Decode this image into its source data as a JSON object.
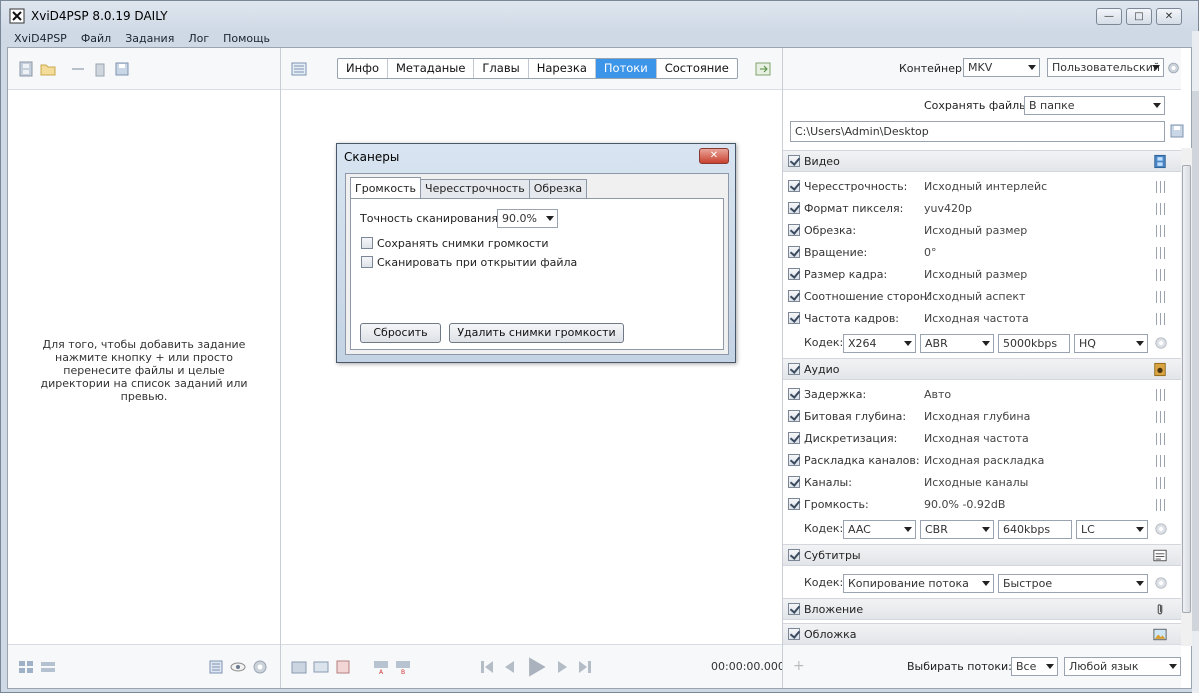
{
  "window": {
    "title": "XviD4PSP 8.0.19 DAILY"
  },
  "menu": [
    "XviD4PSP",
    "Файл",
    "Задания",
    "Лог",
    "Помощь"
  ],
  "left_pane": {
    "hint": "Для того, чтобы добавить задание нажмите кнопку + или просто перенесите файлы и целые директории на список заданий или превью."
  },
  "center_pane": {
    "tabs": [
      "Инфо",
      "Метаданые",
      "Главы",
      "Нарезка",
      "Потоки",
      "Состояние"
    ],
    "active_tab": "Потоки",
    "time": "00:00:00.000"
  },
  "dialog": {
    "title": "Сканеры",
    "close": "✕",
    "tabs": [
      "Громкость",
      "Чересстрочность",
      "Обрезка"
    ],
    "active_tab": "Громкость",
    "accuracy_label": "Точность сканирования:",
    "accuracy_value": "90.0%",
    "save_snapshots_label": "Сохранять снимки громкости",
    "scan_on_open_label": "Сканировать при открытии файла",
    "reset_button": "Сбросить",
    "delete_button": "Удалить снимки громкости"
  },
  "right_pane": {
    "container_label": "Контейнер:",
    "container_value": "MKV",
    "profile_value": "Пользовательский",
    "save_files_label": "Сохранять файлы:",
    "save_files_value": "В папке",
    "output_path": "C:\\Users\\Admin\\Desktop",
    "video": {
      "header": "Видео",
      "rows": [
        {
          "key": "Чересстрочность:",
          "value": "Исходный интерлейс"
        },
        {
          "key": "Формат пикселя:",
          "value": "yuv420p"
        },
        {
          "key": "Обрезка:",
          "value": "Исходный размер"
        },
        {
          "key": "Вращение:",
          "value": "0°"
        },
        {
          "key": "Размер кадра:",
          "value": "Исходный размер"
        },
        {
          "key": "Соотношение сторон:",
          "value": "Исходный аспект"
        },
        {
          "key": "Частота кадров:",
          "value": "Исходная частота"
        }
      ],
      "codec_label": "Кодек:",
      "codec": "X264",
      "mode": "ABR",
      "bitrate": "5000kbps",
      "preset": "HQ"
    },
    "audio": {
      "header": "Аудио",
      "rows": [
        {
          "key": "Задержка:",
          "value": "Авто"
        },
        {
          "key": "Битовая глубина:",
          "value": "Исходная глубина"
        },
        {
          "key": "Дискретизация:",
          "value": "Исходная частота"
        },
        {
          "key": "Раскладка каналов:",
          "value": "Исходная раскладка"
        },
        {
          "key": "Каналы:",
          "value": "Исходные каналы"
        },
        {
          "key": "Громкость:",
          "value": "90.0% -0.92dB"
        }
      ],
      "codec_label": "Кодек:",
      "codec": "AAC",
      "mode": "CBR",
      "bitrate": "640kbps",
      "profile": "LC"
    },
    "subtitles": {
      "header": "Субтитры",
      "codec_label": "Кодек:",
      "codec": "Копирование потока",
      "speed": "Быстрое"
    },
    "attachments_header": "Вложение",
    "cover_header": "Обложка",
    "streams_label": "Выбирать потоки:",
    "streams_value": "Все",
    "language_value": "Любой язык"
  }
}
